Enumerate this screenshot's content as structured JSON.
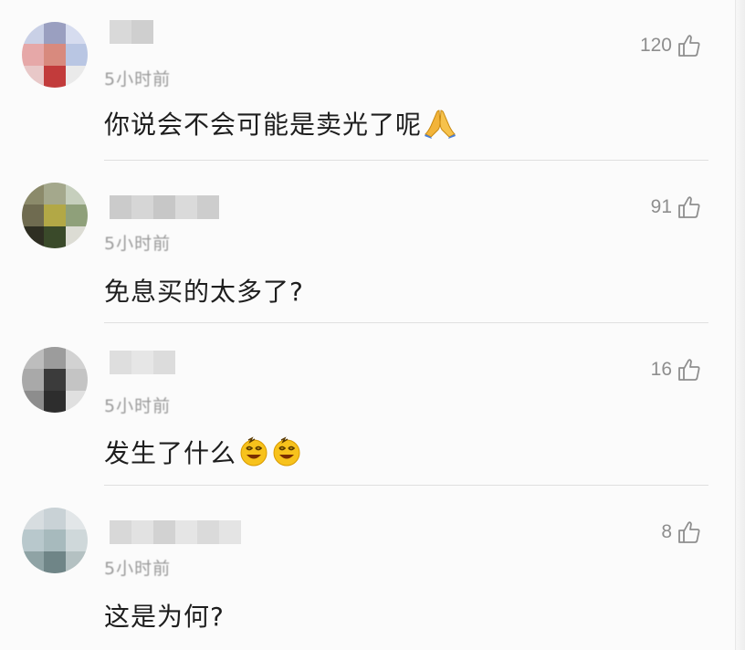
{
  "comments": [
    {
      "likes": "120",
      "time": "5小时前",
      "text": "你说会不会可能是卖光了呢",
      "emoji": [
        "pray-icon"
      ]
    },
    {
      "likes": "91",
      "time": "5小时前",
      "text": "免息买的太多了?",
      "emoji": []
    },
    {
      "likes": "16",
      "time": "5小时前",
      "text": "发生了什么",
      "emoji": [
        "dizzy-smile-icon",
        "dizzy-smile-icon"
      ]
    },
    {
      "likes": "8",
      "time": "5小时前",
      "text": "这是为何?",
      "emoji": []
    }
  ],
  "colors": {
    "background": "#fbfbfb",
    "text": "#1e1e1e",
    "muted": "#8e8e8e",
    "divider": "#e0e0e0",
    "emoji_yellow": "#f7c21c"
  }
}
